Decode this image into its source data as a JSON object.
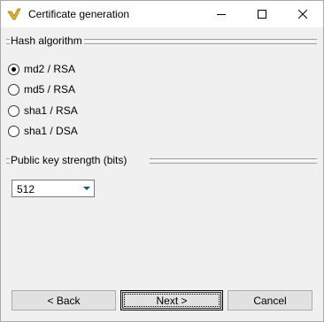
{
  "window": {
    "title": "Certificate generation",
    "icon": "checkmark-logo-icon"
  },
  "hash": {
    "label": "Hash algorithm",
    "options": [
      "md2 / RSA",
      "md5 / RSA",
      "sha1 / RSA",
      "sha1 / DSA"
    ],
    "selected": "md2 / RSA"
  },
  "keystrength": {
    "label": "Public key strength (bits)",
    "value": "512"
  },
  "buttons": {
    "back": "< Back",
    "next": "Next >",
    "cancel": "Cancel"
  },
  "colors": {
    "window_bg": "#f0f0f0",
    "icon_gold": "#e8b622",
    "arrow_blue": "#1a4f8b"
  }
}
